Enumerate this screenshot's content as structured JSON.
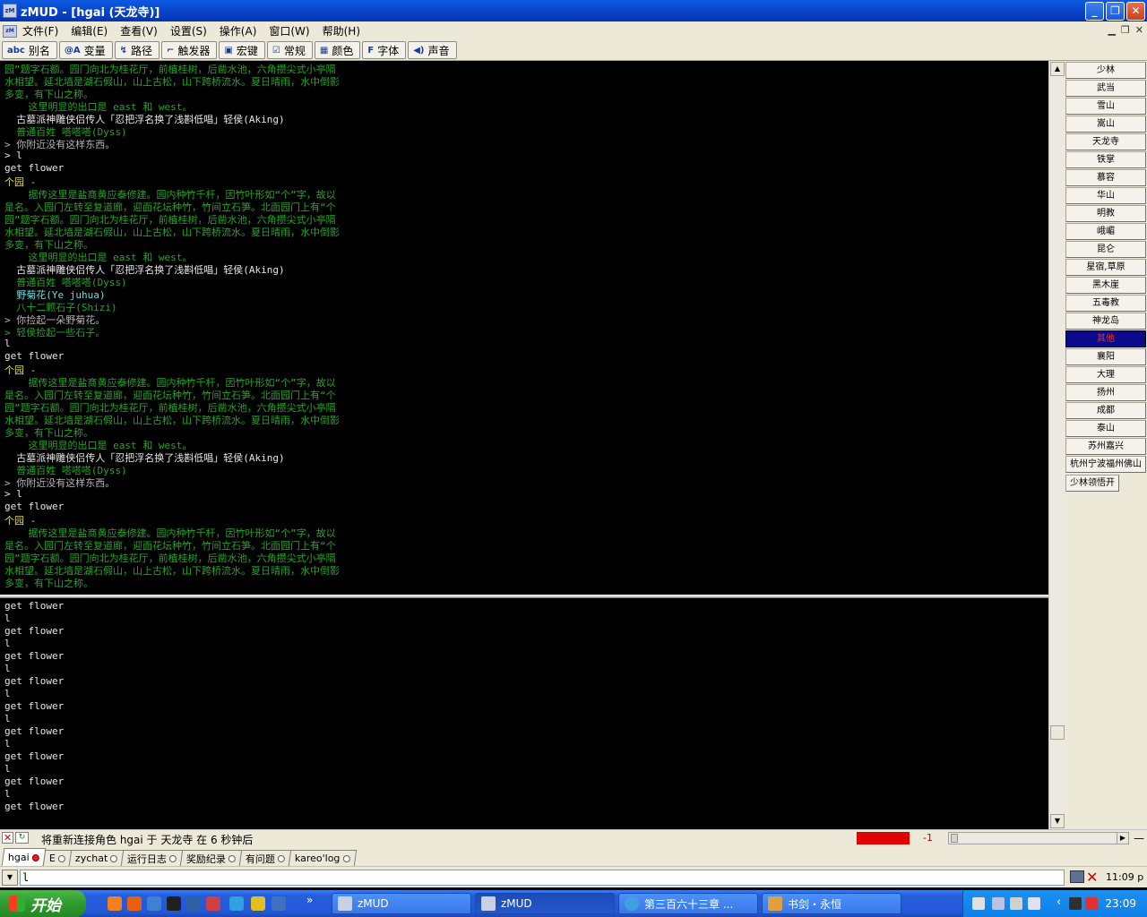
{
  "window": {
    "title": "zMUD - [hgai (天龙寺)]",
    "app_icon": "zmud-icon"
  },
  "menu": [
    "文件(F)",
    "编辑(E)",
    "查看(V)",
    "设置(S)",
    "操作(A)",
    "窗口(W)",
    "帮助(H)"
  ],
  "toolbar": [
    {
      "icon": "abc",
      "label": "别名"
    },
    {
      "icon": "@A",
      "label": "变量"
    },
    {
      "icon": "↯",
      "label": "路径"
    },
    {
      "icon": "⌐",
      "label": "触发器"
    },
    {
      "icon": "▣",
      "label": "宏键"
    },
    {
      "icon": "☑",
      "label": "常规"
    },
    {
      "icon": "▦",
      "label": "颜色"
    },
    {
      "icon": "F",
      "label": "字体"
    },
    {
      "icon": "◀)",
      "label": "声音"
    }
  ],
  "main_output": [
    {
      "t": "园”题字石额。园门向北为桂花厅，前植桂树，后凿水池，六角攒尖式小亭隔",
      "c": "g"
    },
    {
      "t": "水相望。延北墙是湖石假山，山上古松，山下跨桥流水。夏日晴雨，水中倒影",
      "c": "g"
    },
    {
      "t": "多变，有下山之称。",
      "c": "g"
    },
    {
      "t": "    这里明显的出口是 east 和 west。",
      "c": "g"
    },
    {
      "t": "  古墓派神雕侠侣传人「忍把浮名换了浅斟低唱」轻侯(Aking)",
      "c": "wh"
    },
    {
      "t": "  普通百姓 嗒嗒嗒(Dyss)",
      "c": "g"
    },
    {
      "t": "> 你附近没有这样东西。",
      "c": "gy"
    },
    {
      "t": "> l",
      "c": "wh"
    },
    {
      "t": "get flower",
      "c": "wh"
    },
    {
      "t": "个园 -",
      "c": "ly"
    },
    {
      "t": "    据传这里是盐商黄应泰修建。园内种竹千杆，因竹叶形如“个”字，故以",
      "c": "g"
    },
    {
      "t": "是名。入园门左转至复道廊，迎面花坛种竹，竹间立石笋。北面园门上有“个",
      "c": "g"
    },
    {
      "t": "园”题字石额。园门向北为桂花厅，前植桂树，后凿水池，六角攒尖式小亭隔",
      "c": "g"
    },
    {
      "t": "水相望。延北墙是湖石假山，山上古松，山下跨桥流水。夏日晴雨，水中倒影",
      "c": "g"
    },
    {
      "t": "多变，有下山之称。",
      "c": "g"
    },
    {
      "t": "    这里明显的出口是 east 和 west。",
      "c": "g"
    },
    {
      "t": "  古墓派神雕侠侣传人「忍把浮名换了浅斟低唱」轻侯(Aking)",
      "c": "wh"
    },
    {
      "t": "  普通百姓 嗒嗒嗒(Dyss)",
      "c": "g"
    },
    {
      "t": "  野菊花(Ye juhua)",
      "c": "cy"
    },
    {
      "t": "  八十二颗石子(Shizi)",
      "c": "g"
    },
    {
      "t": "> 你捡起一朵野菊花。",
      "c": "gy"
    },
    {
      "t": "> 轻侯捡起一些石子。",
      "c": "g"
    },
    {
      "t": "l",
      "c": "wh"
    },
    {
      "t": "get flower",
      "c": "wh"
    },
    {
      "t": "个园 -",
      "c": "ly"
    },
    {
      "t": "    据传这里是盐商黄应泰修建。园内种竹千杆，因竹叶形如“个”字，故以",
      "c": "g"
    },
    {
      "t": "是名。入园门左转至复道廊，迎面花坛种竹，竹间立石笋。北面园门上有“个",
      "c": "g"
    },
    {
      "t": "园”题字石额。园门向北为桂花厅，前植桂树，后凿水池，六角攒尖式小亭隔",
      "c": "g"
    },
    {
      "t": "水相望。延北墙是湖石假山，山上古松，山下跨桥流水。夏日晴雨，水中倒影",
      "c": "g"
    },
    {
      "t": "多变，有下山之称。",
      "c": "g"
    },
    {
      "t": "    这里明显的出口是 east 和 west。",
      "c": "g"
    },
    {
      "t": "  古墓派神雕侠侣传人「忍把浮名换了浅斟低唱」轻侯(Aking)",
      "c": "wh"
    },
    {
      "t": "  普通百姓 嗒嗒嗒(Dyss)",
      "c": "g"
    },
    {
      "t": "> 你附近没有这样东西。",
      "c": "gy"
    },
    {
      "t": "> l",
      "c": "wh"
    },
    {
      "t": "get flower",
      "c": "wh"
    },
    {
      "t": "个园 -",
      "c": "ly"
    },
    {
      "t": "    据传这里是盐商黄应泰修建。园内种竹千杆，因竹叶形如“个”字，故以",
      "c": "g"
    },
    {
      "t": "是名。入园门左转至复道廊，迎面花坛种竹，竹间立石笋。北面园门上有“个",
      "c": "g"
    },
    {
      "t": "园”题字石额。园门向北为桂花厅，前植桂树，后凿水池，六角攒尖式小亭隔",
      "c": "g"
    },
    {
      "t": "水相望。延北墙是湖石假山，山上古松，山下跨桥流水。夏日晴雨，水中倒影",
      "c": "g"
    },
    {
      "t": "多变，有下山之称。",
      "c": "g"
    }
  ],
  "command_output": [
    "get flower",
    "l",
    "get flower",
    "l",
    "get flower",
    "l",
    "get flower",
    "l",
    "get flower",
    "l",
    "get flower",
    "l",
    "get flower",
    "l",
    "get flower",
    "l",
    "get flower"
  ],
  "right_panel": [
    "少林",
    "武当",
    "雪山",
    "嵩山",
    "天龙寺",
    "铁掌",
    "慕容",
    "华山",
    "明教",
    "峨嵋",
    "昆仑",
    "星宿,草原",
    "黑木崖",
    "五毒教",
    "神龙岛",
    "其他",
    "襄阳",
    "大理",
    "扬州",
    "成都",
    "泰山",
    "苏州嘉兴",
    "杭州宁波福州佛山",
    "少林领悟开"
  ],
  "right_panel_selected": "其他",
  "status": {
    "message": "将重新连接角色 hgai 于 天龙寺 在 6 秒钟后",
    "value": "-1",
    "dash": "—"
  },
  "sessions": [
    "hgai",
    "E",
    "zychat",
    "运行日志",
    "奖励纪录",
    "有问题",
    "kareo'log"
  ],
  "input": {
    "value": "l",
    "time": "11:09 p"
  },
  "taskbar": {
    "start": "开始",
    "quicklaunch_more": "»",
    "items": [
      "zMUD",
      "zMUD",
      "第三百六十三章 ...",
      "书剑・永恒"
    ],
    "tray_arrow": "‹",
    "clock": "23:09"
  },
  "colors": {
    "g": "#23a523",
    "ly": "#e0e040",
    "wh": "#e6e6e6",
    "gy": "#b4b4b4",
    "cy": "#60e0e0",
    "selected_bg": "#0a0a8a",
    "selected_fg": "#e03030"
  }
}
